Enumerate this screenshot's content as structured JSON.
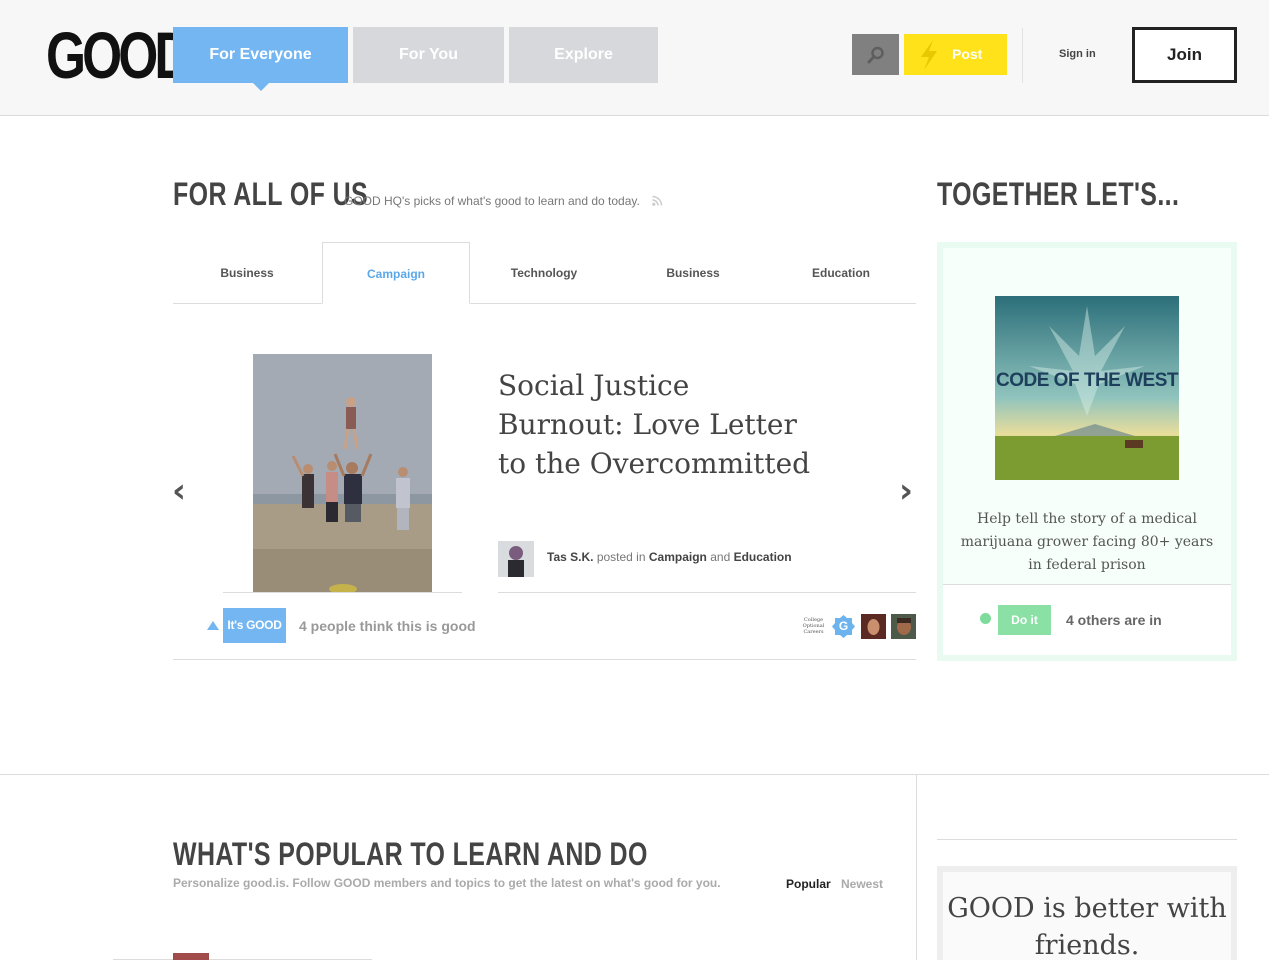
{
  "header": {
    "logo": "GOOD",
    "tabs": [
      {
        "label": "For Everyone",
        "active": true
      },
      {
        "label": "For You",
        "active": false
      },
      {
        "label": "Explore",
        "active": false
      }
    ],
    "post_label": "Post",
    "signin_label": "Sign in",
    "join_label": "Join",
    "colors": {
      "active_tab": "#73b6f1",
      "inactive_tab": "#d7d8dc",
      "post": "#ffe21a"
    }
  },
  "feature_section": {
    "title": "FOR ALL OF US",
    "subtitle": "GOOD HQ's picks of what's good to learn and do today.",
    "topic_tabs": [
      {
        "label": "Business",
        "selected": false
      },
      {
        "label": "Campaign",
        "selected": true
      },
      {
        "label": "Technology",
        "selected": false
      },
      {
        "label": "Business",
        "selected": false
      },
      {
        "label": "Education",
        "selected": false
      }
    ],
    "prev_arrow": "‹",
    "next_arrow": "›",
    "article": {
      "title": "Social Justice Burnout: Love Letter to the Overcommitted",
      "author": "Tas S.K.",
      "posted_in": "posted in",
      "category_1": "Campaign",
      "conjunction": "and",
      "category_2": "Education"
    },
    "its_good_label": "It's GOOD",
    "good_count_text": "4 people think this is good",
    "mini_avatar_text": "College Optional Careers",
    "mini_avatar_badge": "G"
  },
  "together": {
    "title": "TOGETHER LET'S...",
    "image_text": "CODE OF THE WEST",
    "description": "Help tell the story of a medical marijuana grower facing 80+ years in federal prison",
    "do_it_label": "Do it",
    "others_text": "4 others are in",
    "colors": {
      "box": "#e9fbf1",
      "button": "#8be0a6"
    }
  },
  "popular": {
    "title": "WHAT'S POPULAR TO LEARN AND DO",
    "subtitle": "Personalize good.is. Follow GOOD members and topics to get the latest on what's good for you.",
    "sort_popular": "Popular",
    "sort_newest": "Newest"
  },
  "friends_box": {
    "text": "GOOD is better with friends."
  }
}
